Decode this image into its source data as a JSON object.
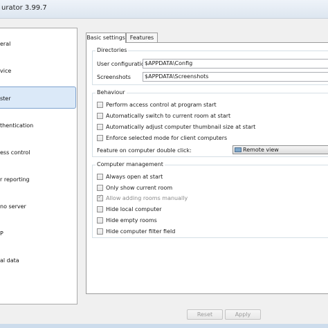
{
  "window": {
    "title": "urator 3.99.7"
  },
  "sidebar": {
    "items": [
      {
        "label": "eral"
      },
      {
        "label": "vice"
      },
      {
        "label": "ster",
        "selected": true
      },
      {
        "label": "thentication"
      },
      {
        "label": "ess control"
      },
      {
        "label": "r reporting"
      },
      {
        "label": "no server"
      },
      {
        "label": "P"
      },
      {
        "label": "al data"
      }
    ]
  },
  "tabs": [
    {
      "label": "Basic settings",
      "active": true
    },
    {
      "label": "Features",
      "active": false
    }
  ],
  "directories": {
    "title": "Directories",
    "user_configuration_label": "User configuration",
    "user_configuration_value": "$APPDATA\\Config",
    "screenshots_label": "Screenshots",
    "screenshots_value": "$APPDATA\\Screenshots"
  },
  "behaviour": {
    "title": "Behaviour",
    "options": [
      {
        "label": "Perform access control at program start",
        "checked": false
      },
      {
        "label": "Automatically switch to current room at start",
        "checked": false
      },
      {
        "label": "Automatically adjust computer thumbnail size at start",
        "checked": false
      },
      {
        "label": "Enforce selected mode for client computers",
        "checked": false
      }
    ],
    "double_click_label": "Feature on computer double click:",
    "double_click_value": "Remote view",
    "double_click_icon": "monitor-icon"
  },
  "computer_management": {
    "title": "Computer management",
    "options": [
      {
        "label": "Always open at start",
        "checked": false,
        "disabled": false
      },
      {
        "label": "Only show current room",
        "checked": false,
        "disabled": false
      },
      {
        "label": "Allow adding rooms manually",
        "checked": true,
        "disabled": true
      },
      {
        "label": "Hide local computer",
        "checked": false,
        "disabled": false
      },
      {
        "label": "Hide empty rooms",
        "checked": false,
        "disabled": false
      },
      {
        "label": "Hide computer filter field",
        "checked": false,
        "disabled": false
      }
    ]
  },
  "footer": {
    "reset_label": "Reset",
    "apply_label": "Apply"
  }
}
